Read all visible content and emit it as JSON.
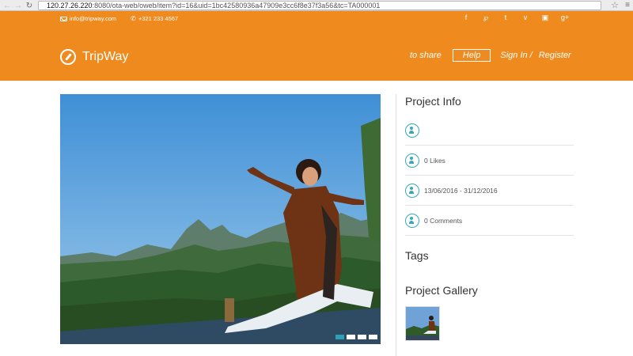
{
  "browser": {
    "back_icon": "back-arrow-icon",
    "forward_icon": "forward-arrow-icon",
    "reload_icon": "reload-icon",
    "url_host": "120.27.26.220",
    "url_rest": ":8080/ota-web/oweb/item?id=16&uid=1bc42580936a47909e3cc6f8e37f3a56&tc=TA000001"
  },
  "topline": {
    "email": "info@tripway.com",
    "phone": "+321 233 4567"
  },
  "socials": [
    "f",
    "℘",
    "t",
    "v",
    "▣",
    "g+"
  ],
  "logo": {
    "text": "TripWay"
  },
  "nav": {
    "share": "to share",
    "help": "Help",
    "sign_in": "Sign In /",
    "register": "Register"
  },
  "sidebar": {
    "project_info_title": "Project Info",
    "rows": [
      {
        "text": ""
      },
      {
        "text": "0 Likes"
      },
      {
        "text": "13/06/2016 -  31/12/2016"
      },
      {
        "text": "0 Comments"
      }
    ],
    "tags_title": "Tags",
    "gallery_title": "Project Gallery"
  },
  "slider": {
    "count": 4,
    "active": 0
  },
  "colors": {
    "brand_orange": "#ef8a1f",
    "accent_teal": "#38a8b8"
  }
}
